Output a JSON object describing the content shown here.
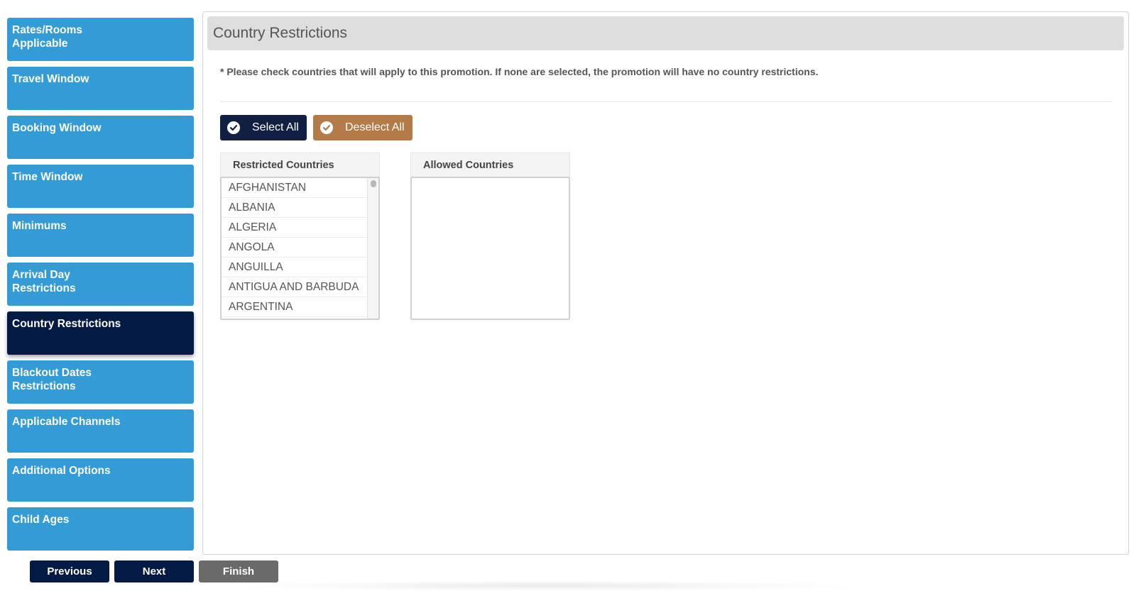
{
  "sidebar": {
    "items": [
      {
        "label": "Rates/Rooms Applicable",
        "active": false
      },
      {
        "label": "Travel Window",
        "active": false
      },
      {
        "label": "Booking Window",
        "active": false
      },
      {
        "label": "Time Window",
        "active": false
      },
      {
        "label": "Minimums",
        "active": false
      },
      {
        "label": "Arrival Day Restrictions",
        "active": false
      },
      {
        "label": "Country Restrictions",
        "active": true
      },
      {
        "label": "Blackout Dates Restrictions",
        "active": false
      },
      {
        "label": "Applicable Channels",
        "active": false
      },
      {
        "label": "Additional Options",
        "active": false
      },
      {
        "label": "Child Ages",
        "active": false
      }
    ]
  },
  "panel": {
    "title": "Country Restrictions",
    "note": "* Please check countries that will apply to this promotion. If none are selected, the promotion will have no country restrictions.",
    "select_all_label": "Select All",
    "deselect_all_label": "Deselect All",
    "restricted": {
      "header": "Restricted Countries",
      "items": [
        "AFGHANISTAN",
        "ALBANIA",
        "ALGERIA",
        "ANGOLA",
        "ANGUILLA",
        "ANTIGUA AND BARBUDA",
        "ARGENTINA"
      ]
    },
    "allowed": {
      "header": "Allowed Countries",
      "items": []
    }
  },
  "footer": {
    "previous_label": "Previous",
    "next_label": "Next",
    "finish_label": "Finish"
  },
  "colors": {
    "sidebar_item": "#339bd6",
    "sidebar_active": "#031a44",
    "select_all": "#111f43",
    "deselect_all": "#b47b48",
    "finish": "#6a6a6a"
  }
}
